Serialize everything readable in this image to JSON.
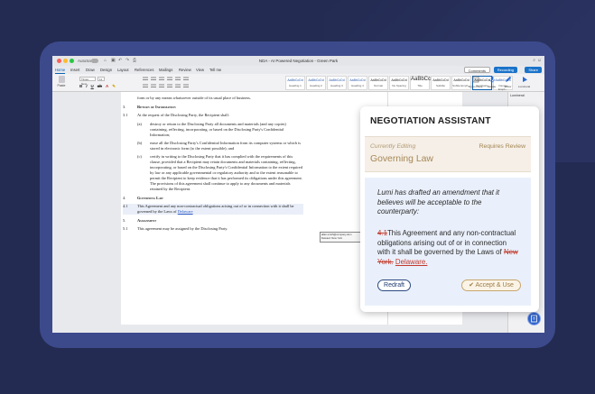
{
  "window": {
    "autosave_label": "AutoSave",
    "title": "NDA - AI Powered Negotiation - Green Park"
  },
  "ribbon": {
    "tabs": [
      "Home",
      "Insert",
      "Draw",
      "Design",
      "Layout",
      "References",
      "Mailings",
      "Review",
      "View",
      "Tell me"
    ],
    "comments_label": "Comments",
    "recording_label": "Recording",
    "share_label": "Share",
    "paste_label": "Paste",
    "font_name": "Times New...",
    "font_size": "11",
    "styles": [
      {
        "sample": "AaBbCcDd",
        "name": "Heading 1"
      },
      {
        "sample": "AaBbCcDd",
        "name": "Heading 2"
      },
      {
        "sample": "AaBbCcDd",
        "name": "Heading 3"
      },
      {
        "sample": "AaBbCcDd",
        "name": "Heading 4"
      },
      {
        "sample": "AaBbCcDd",
        "name": "Normal"
      },
      {
        "sample": "AaBbCcDd",
        "name": "No Spacing"
      },
      {
        "sample": "AaBbCc",
        "name": "Title"
      },
      {
        "sample": "AaBbCcDd",
        "name": "Subtitle"
      },
      {
        "sample": "AaBbCcDd",
        "name": "Subtle Emph..."
      },
      {
        "sample": "AaBbCcDd",
        "name": "Emphasis"
      },
      {
        "sample": "AaBbCcDd",
        "name": "Intense Emph..."
      }
    ],
    "right_tools": [
      "Styles Pane",
      "Dictate",
      "Editor",
      "Lumineral"
    ]
  },
  "side_pane": {
    "title": "Lumineral"
  },
  "document": {
    "prev_line": "form or by any means whatsoever outside of its usual place of business.",
    "s3_num": "3.",
    "s3_heading": "Return of Information",
    "s31_num": "3.1",
    "s31_text": "At the request of the Disclosing Party, the Recipient shall:",
    "a_label": "(a)",
    "a_text": "destroy or return to the Disclosing Party all documents and materials (and any copies) containing, reflecting, incorporating, or based on the Disclosing Party's Confidential Information;",
    "b_label": "(b)",
    "b_text": "erase all the Disclosing Party's Confidential Information from its computer systems or which is stored in electronic form (to the extent possible); and",
    "c_label": "(c)",
    "c_text": "certify in writing to the Disclosing Party that it has complied with the requirements of this clause, provided that a Recipient may retain documents and materials containing, reflecting, incorporating, or based on the Disclosing Party's Confidential Information to the extent required by law or any applicable governmental or regulatory authority and to the extent reasonable to permit the Recipient to keep evidence that it has performed its obligations under this agreement. The provisions of this agreement shall continue to apply to any documents and materials retained by the Recipient.",
    "s4_num": "4.",
    "s4_heading": "Governing Law",
    "s41_num": "4.1",
    "s41_text": "This Agreement and any non-contractual obligations arising out of or in connection with it shall be governed by the Laws of",
    "s41_link": "Delaware",
    "s5_num": "5.",
    "s5_heading": "Assignment",
    "s51_num": "5.1",
    "s51_text": "This agreement may be assigned by the Disclosing Party.",
    "comment_line1": "allan.smith@company.dom",
    "comment_line2": "Deleted: New York"
  },
  "panel": {
    "title": "NEGOTIATION ASSISTANT",
    "currently_editing": "Currently Editing",
    "requires_review": "Requires Review",
    "section_name": "Governing Law",
    "lumi_message": "Lumi has drafted an amendment that it believes will be acceptable to the counterparty:",
    "amend_deleted_num": "4.1",
    "amend_text": "This Agreement and any non-contractual obligations arising out of or in connection with it shall be governed by the Laws of",
    "amend_deleted_place": "New York.",
    "amend_inserted_place": "Delaware.",
    "redraft_label": "Redraft",
    "accept_label": "Accept & Use"
  },
  "colors": {
    "background": "#232b52",
    "frame": "#3c4a8c",
    "accent_blue": "#1a73c9",
    "review_tan": "#a78755",
    "redline": "#c0392b"
  }
}
